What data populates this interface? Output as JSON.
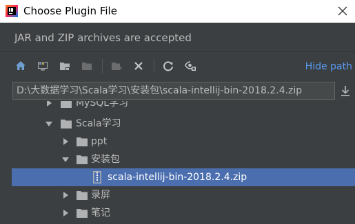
{
  "window": {
    "title": "Choose Plugin File"
  },
  "description": "JAR and ZIP archives are accepted",
  "toolbar": {
    "buttons": [
      {
        "icon": "home-icon"
      },
      {
        "icon": "desktop-icon"
      },
      {
        "icon": "project-folder-icon"
      },
      {
        "icon": "module-folder-icon"
      },
      {
        "icon": "new-folder-icon"
      },
      {
        "icon": "delete-icon"
      },
      {
        "icon": "refresh-icon"
      },
      {
        "icon": "show-hidden-icon"
      }
    ],
    "hide_path_label": "Hide path"
  },
  "path": {
    "value": "D:\\大数据学习\\Scala学习\\安装包\\scala-intellij-bin-2018.2.4.zip"
  },
  "tree": {
    "items": [
      {
        "label": "MySQL学习",
        "type": "folder",
        "expanded": false,
        "depth": 1
      },
      {
        "label": "Scala学习",
        "type": "folder",
        "expanded": true,
        "depth": 1
      },
      {
        "label": "ppt",
        "type": "folder",
        "expanded": false,
        "depth": 2
      },
      {
        "label": "安装包",
        "type": "folder",
        "expanded": true,
        "depth": 2
      },
      {
        "label": "scala-intellij-bin-2018.2.4.zip",
        "type": "zip-file",
        "selected": true,
        "depth": 3
      },
      {
        "label": "录屏",
        "type": "folder",
        "expanded": false,
        "depth": 2
      },
      {
        "label": "笔记",
        "type": "folder",
        "expanded": false,
        "depth": 2
      }
    ]
  },
  "colors": {
    "background": "#3c3f41",
    "selection": "#4b6eaf",
    "link": "#589df6",
    "text": "#bbbbbb"
  }
}
